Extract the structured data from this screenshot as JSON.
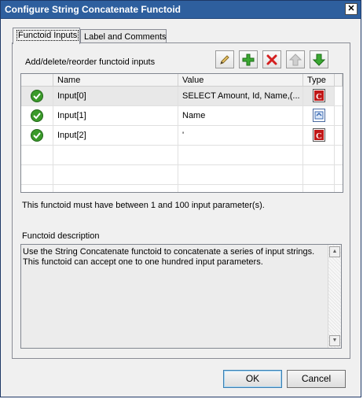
{
  "window": {
    "title": "Configure String Concatenate Functoid",
    "close_glyph": "✕"
  },
  "tabs": [
    {
      "label": "Functoid Inputs",
      "active": true
    },
    {
      "label": "Label and Comments",
      "active": false
    }
  ],
  "inputs_section": {
    "label": "Add/delete/reorder functoid inputs",
    "toolbar": [
      "edit-icon",
      "add-icon",
      "delete-icon",
      "move-up-icon",
      "move-down-icon"
    ],
    "columns": {
      "name": "Name",
      "value": "Value",
      "type": "Type"
    },
    "rows": [
      {
        "name": "Input[0]",
        "value": "SELECT Amount, Id, Name,(...",
        "type": "constant",
        "selected": true
      },
      {
        "name": "Input[1]",
        "value": "Name",
        "type": "link",
        "selected": false
      },
      {
        "name": "Input[2]",
        "value": "'",
        "type": "constant",
        "selected": false
      }
    ],
    "note": "This functoid must have between 1 and 100 input parameter(s)."
  },
  "description": {
    "label": "Functoid description",
    "text": "Use the String Concatenate functoid to concatenate a series of input strings. This functoid can accept one to one hundred input parameters."
  },
  "buttons": {
    "ok": "OK",
    "cancel": "Cancel"
  },
  "colors": {
    "titlebar": "#2e5f9e",
    "add": "#3aa832",
    "delete": "#d42020",
    "check": "#3a9a2a"
  }
}
